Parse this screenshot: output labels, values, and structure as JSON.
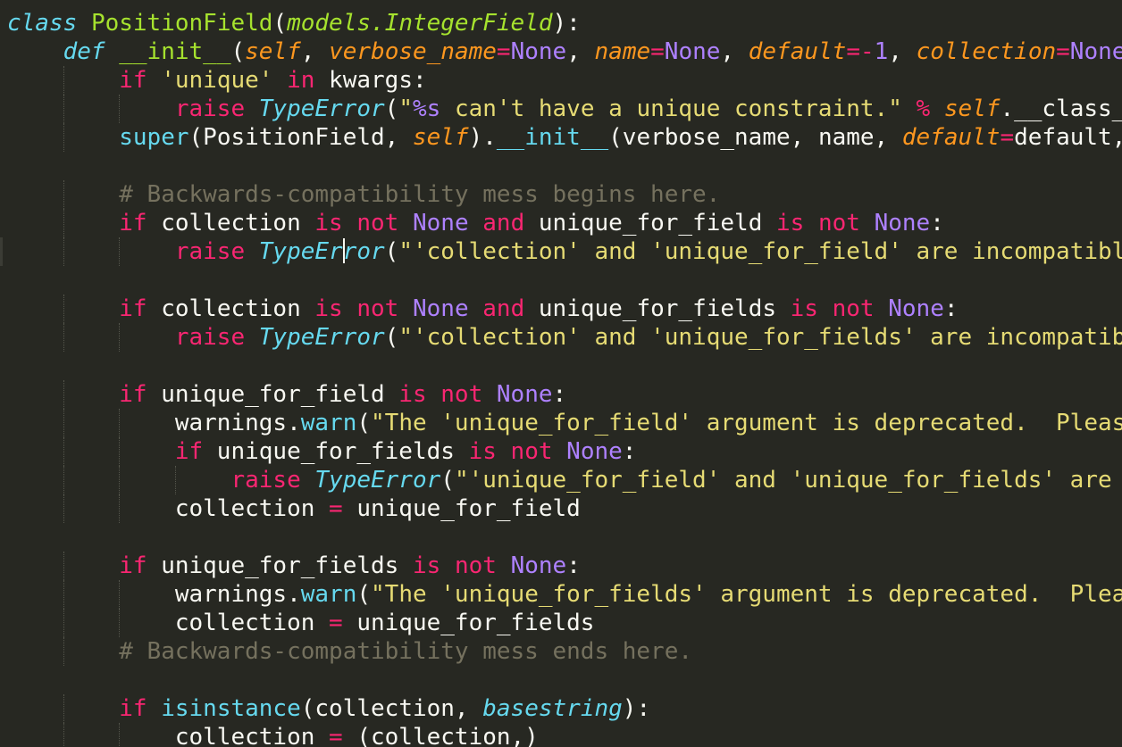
{
  "colors": {
    "background": "#272822",
    "foreground": "#f8f8f2",
    "keyword": "#f92672",
    "function_name": "#a6e22e",
    "parameter": "#fd971f",
    "constant": "#ae81ff",
    "string": "#e6db74",
    "builtin": "#66d9ef",
    "comment": "#75715e"
  },
  "cursor": {
    "line": 8,
    "column": 12
  },
  "lines": [
    {
      "indent": 0,
      "tokens": [
        [
          "st",
          "class"
        ],
        [
          "tx",
          " "
        ],
        [
          "fn",
          "PositionField"
        ],
        [
          "tx",
          "("
        ],
        [
          "inh",
          "models.IntegerField"
        ],
        [
          "tx",
          "):"
        ]
      ]
    },
    {
      "indent": 1,
      "tokens": [
        [
          "st",
          "def"
        ],
        [
          "tx",
          " "
        ],
        [
          "fn",
          "__init__"
        ],
        [
          "tx",
          "("
        ],
        [
          "par",
          "self"
        ],
        [
          "tx",
          ", "
        ],
        [
          "par",
          "verbose_name"
        ],
        [
          "kw",
          "="
        ],
        [
          "cst",
          "None"
        ],
        [
          "tx",
          ", "
        ],
        [
          "par",
          "name"
        ],
        [
          "kw",
          "="
        ],
        [
          "cst",
          "None"
        ],
        [
          "tx",
          ", "
        ],
        [
          "par",
          "default"
        ],
        [
          "kw",
          "=-"
        ],
        [
          "cst",
          "1"
        ],
        [
          "tx",
          ", "
        ],
        [
          "par",
          "collection"
        ],
        [
          "kw",
          "="
        ],
        [
          "cst",
          "None"
        ]
      ]
    },
    {
      "indent": 2,
      "tokens": [
        [
          "kw",
          "if"
        ],
        [
          "tx",
          " "
        ],
        [
          "str",
          "'unique'"
        ],
        [
          "tx",
          " "
        ],
        [
          "kw",
          "in"
        ],
        [
          "tx",
          " kwargs:"
        ]
      ]
    },
    {
      "indent": 3,
      "tokens": [
        [
          "kw",
          "raise"
        ],
        [
          "tx",
          " "
        ],
        [
          "st",
          "TypeError"
        ],
        [
          "tx",
          "("
        ],
        [
          "str",
          "\""
        ],
        [
          "cst",
          "%s"
        ],
        [
          "str",
          " can't have a unique constraint.\""
        ],
        [
          "tx",
          " "
        ],
        [
          "kw",
          "%"
        ],
        [
          "tx",
          " "
        ],
        [
          "par",
          "self"
        ],
        [
          "tx",
          ".__class_"
        ]
      ]
    },
    {
      "indent": 2,
      "tokens": [
        [
          "bi",
          "super"
        ],
        [
          "tx",
          "(PositionField, "
        ],
        [
          "par",
          "self"
        ],
        [
          "tx",
          ")."
        ],
        [
          "bi",
          "__init__"
        ],
        [
          "tx",
          "(verbose_name, name, "
        ],
        [
          "par",
          "default"
        ],
        [
          "kw",
          "="
        ],
        [
          "tx",
          "default,"
        ]
      ]
    },
    {
      "indent": 0,
      "tokens": []
    },
    {
      "indent": 2,
      "tokens": [
        [
          "cm",
          "# Backwards-compatibility mess begins here."
        ]
      ]
    },
    {
      "indent": 2,
      "tokens": [
        [
          "kw",
          "if"
        ],
        [
          "tx",
          " "
        ],
        [
          "tx",
          "collection "
        ],
        [
          "kw",
          "is"
        ],
        [
          "tx",
          " "
        ],
        [
          "kw",
          "not"
        ],
        [
          "tx",
          " "
        ],
        [
          "cst",
          "None"
        ],
        [
          "tx",
          " "
        ],
        [
          "kw",
          "and"
        ],
        [
          "tx",
          " unique_for_field "
        ],
        [
          "kw",
          "is"
        ],
        [
          "tx",
          " "
        ],
        [
          "kw",
          "not"
        ],
        [
          "tx",
          " "
        ],
        [
          "cst",
          "None"
        ],
        [
          "tx",
          ":"
        ]
      ]
    },
    {
      "indent": 3,
      "tokens": [
        [
          "kw",
          "raise"
        ],
        [
          "tx",
          " "
        ],
        [
          "st",
          "TypeError"
        ],
        [
          "tx",
          "("
        ],
        [
          "str",
          "\"'collection' and 'unique_for_field' are incompatibl"
        ]
      ]
    },
    {
      "indent": 0,
      "tokens": []
    },
    {
      "indent": 2,
      "tokens": [
        [
          "kw",
          "if"
        ],
        [
          "tx",
          " collection "
        ],
        [
          "kw",
          "is"
        ],
        [
          "tx",
          " "
        ],
        [
          "kw",
          "not"
        ],
        [
          "tx",
          " "
        ],
        [
          "cst",
          "None"
        ],
        [
          "tx",
          " "
        ],
        [
          "kw",
          "and"
        ],
        [
          "tx",
          " unique_for_fields "
        ],
        [
          "kw",
          "is"
        ],
        [
          "tx",
          " "
        ],
        [
          "kw",
          "not"
        ],
        [
          "tx",
          " "
        ],
        [
          "cst",
          "None"
        ],
        [
          "tx",
          ":"
        ]
      ]
    },
    {
      "indent": 3,
      "tokens": [
        [
          "kw",
          "raise"
        ],
        [
          "tx",
          " "
        ],
        [
          "st",
          "TypeError"
        ],
        [
          "tx",
          "("
        ],
        [
          "str",
          "\"'collection' and 'unique_for_fields' are incompatib"
        ]
      ]
    },
    {
      "indent": 0,
      "tokens": []
    },
    {
      "indent": 2,
      "tokens": [
        [
          "kw",
          "if"
        ],
        [
          "tx",
          " unique_for_field "
        ],
        [
          "kw",
          "is"
        ],
        [
          "tx",
          " "
        ],
        [
          "kw",
          "not"
        ],
        [
          "tx",
          " "
        ],
        [
          "cst",
          "None"
        ],
        [
          "tx",
          ":"
        ]
      ]
    },
    {
      "indent": 3,
      "tokens": [
        [
          "tx",
          "warnings."
        ],
        [
          "bi",
          "warn"
        ],
        [
          "tx",
          "("
        ],
        [
          "str",
          "\"The 'unique_for_field' argument is deprecated.  Pleas"
        ]
      ]
    },
    {
      "indent": 3,
      "tokens": [
        [
          "kw",
          "if"
        ],
        [
          "tx",
          " unique_for_fields "
        ],
        [
          "kw",
          "is"
        ],
        [
          "tx",
          " "
        ],
        [
          "kw",
          "not"
        ],
        [
          "tx",
          " "
        ],
        [
          "cst",
          "None"
        ],
        [
          "tx",
          ":"
        ]
      ]
    },
    {
      "indent": 4,
      "tokens": [
        [
          "kw",
          "raise"
        ],
        [
          "tx",
          " "
        ],
        [
          "st",
          "TypeError"
        ],
        [
          "tx",
          "("
        ],
        [
          "str",
          "\"'unique_for_field' and 'unique_for_fields' are "
        ]
      ]
    },
    {
      "indent": 3,
      "tokens": [
        [
          "tx",
          "collection "
        ],
        [
          "kw",
          "="
        ],
        [
          "tx",
          " unique_for_field"
        ]
      ]
    },
    {
      "indent": 0,
      "tokens": []
    },
    {
      "indent": 2,
      "tokens": [
        [
          "kw",
          "if"
        ],
        [
          "tx",
          " unique_for_fields "
        ],
        [
          "kw",
          "is"
        ],
        [
          "tx",
          " "
        ],
        [
          "kw",
          "not"
        ],
        [
          "tx",
          " "
        ],
        [
          "cst",
          "None"
        ],
        [
          "tx",
          ":"
        ]
      ]
    },
    {
      "indent": 3,
      "tokens": [
        [
          "tx",
          "warnings."
        ],
        [
          "bi",
          "warn"
        ],
        [
          "tx",
          "("
        ],
        [
          "str",
          "\"The 'unique_for_fields' argument is deprecated.  Plea"
        ]
      ]
    },
    {
      "indent": 3,
      "tokens": [
        [
          "tx",
          "collection "
        ],
        [
          "kw",
          "="
        ],
        [
          "tx",
          " unique_for_fields"
        ]
      ]
    },
    {
      "indent": 2,
      "tokens": [
        [
          "cm",
          "# Backwards-compatibility mess ends here."
        ]
      ]
    },
    {
      "indent": 0,
      "tokens": []
    },
    {
      "indent": 2,
      "tokens": [
        [
          "kw",
          "if"
        ],
        [
          "tx",
          " "
        ],
        [
          "bi",
          "isinstance"
        ],
        [
          "tx",
          "(collection, "
        ],
        [
          "st",
          "basestring"
        ],
        [
          "tx",
          "):"
        ]
      ]
    },
    {
      "indent": 3,
      "tokens": [
        [
          "tx",
          "collection "
        ],
        [
          "kw",
          "="
        ],
        [
          "tx",
          " (collection,)"
        ]
      ]
    }
  ]
}
